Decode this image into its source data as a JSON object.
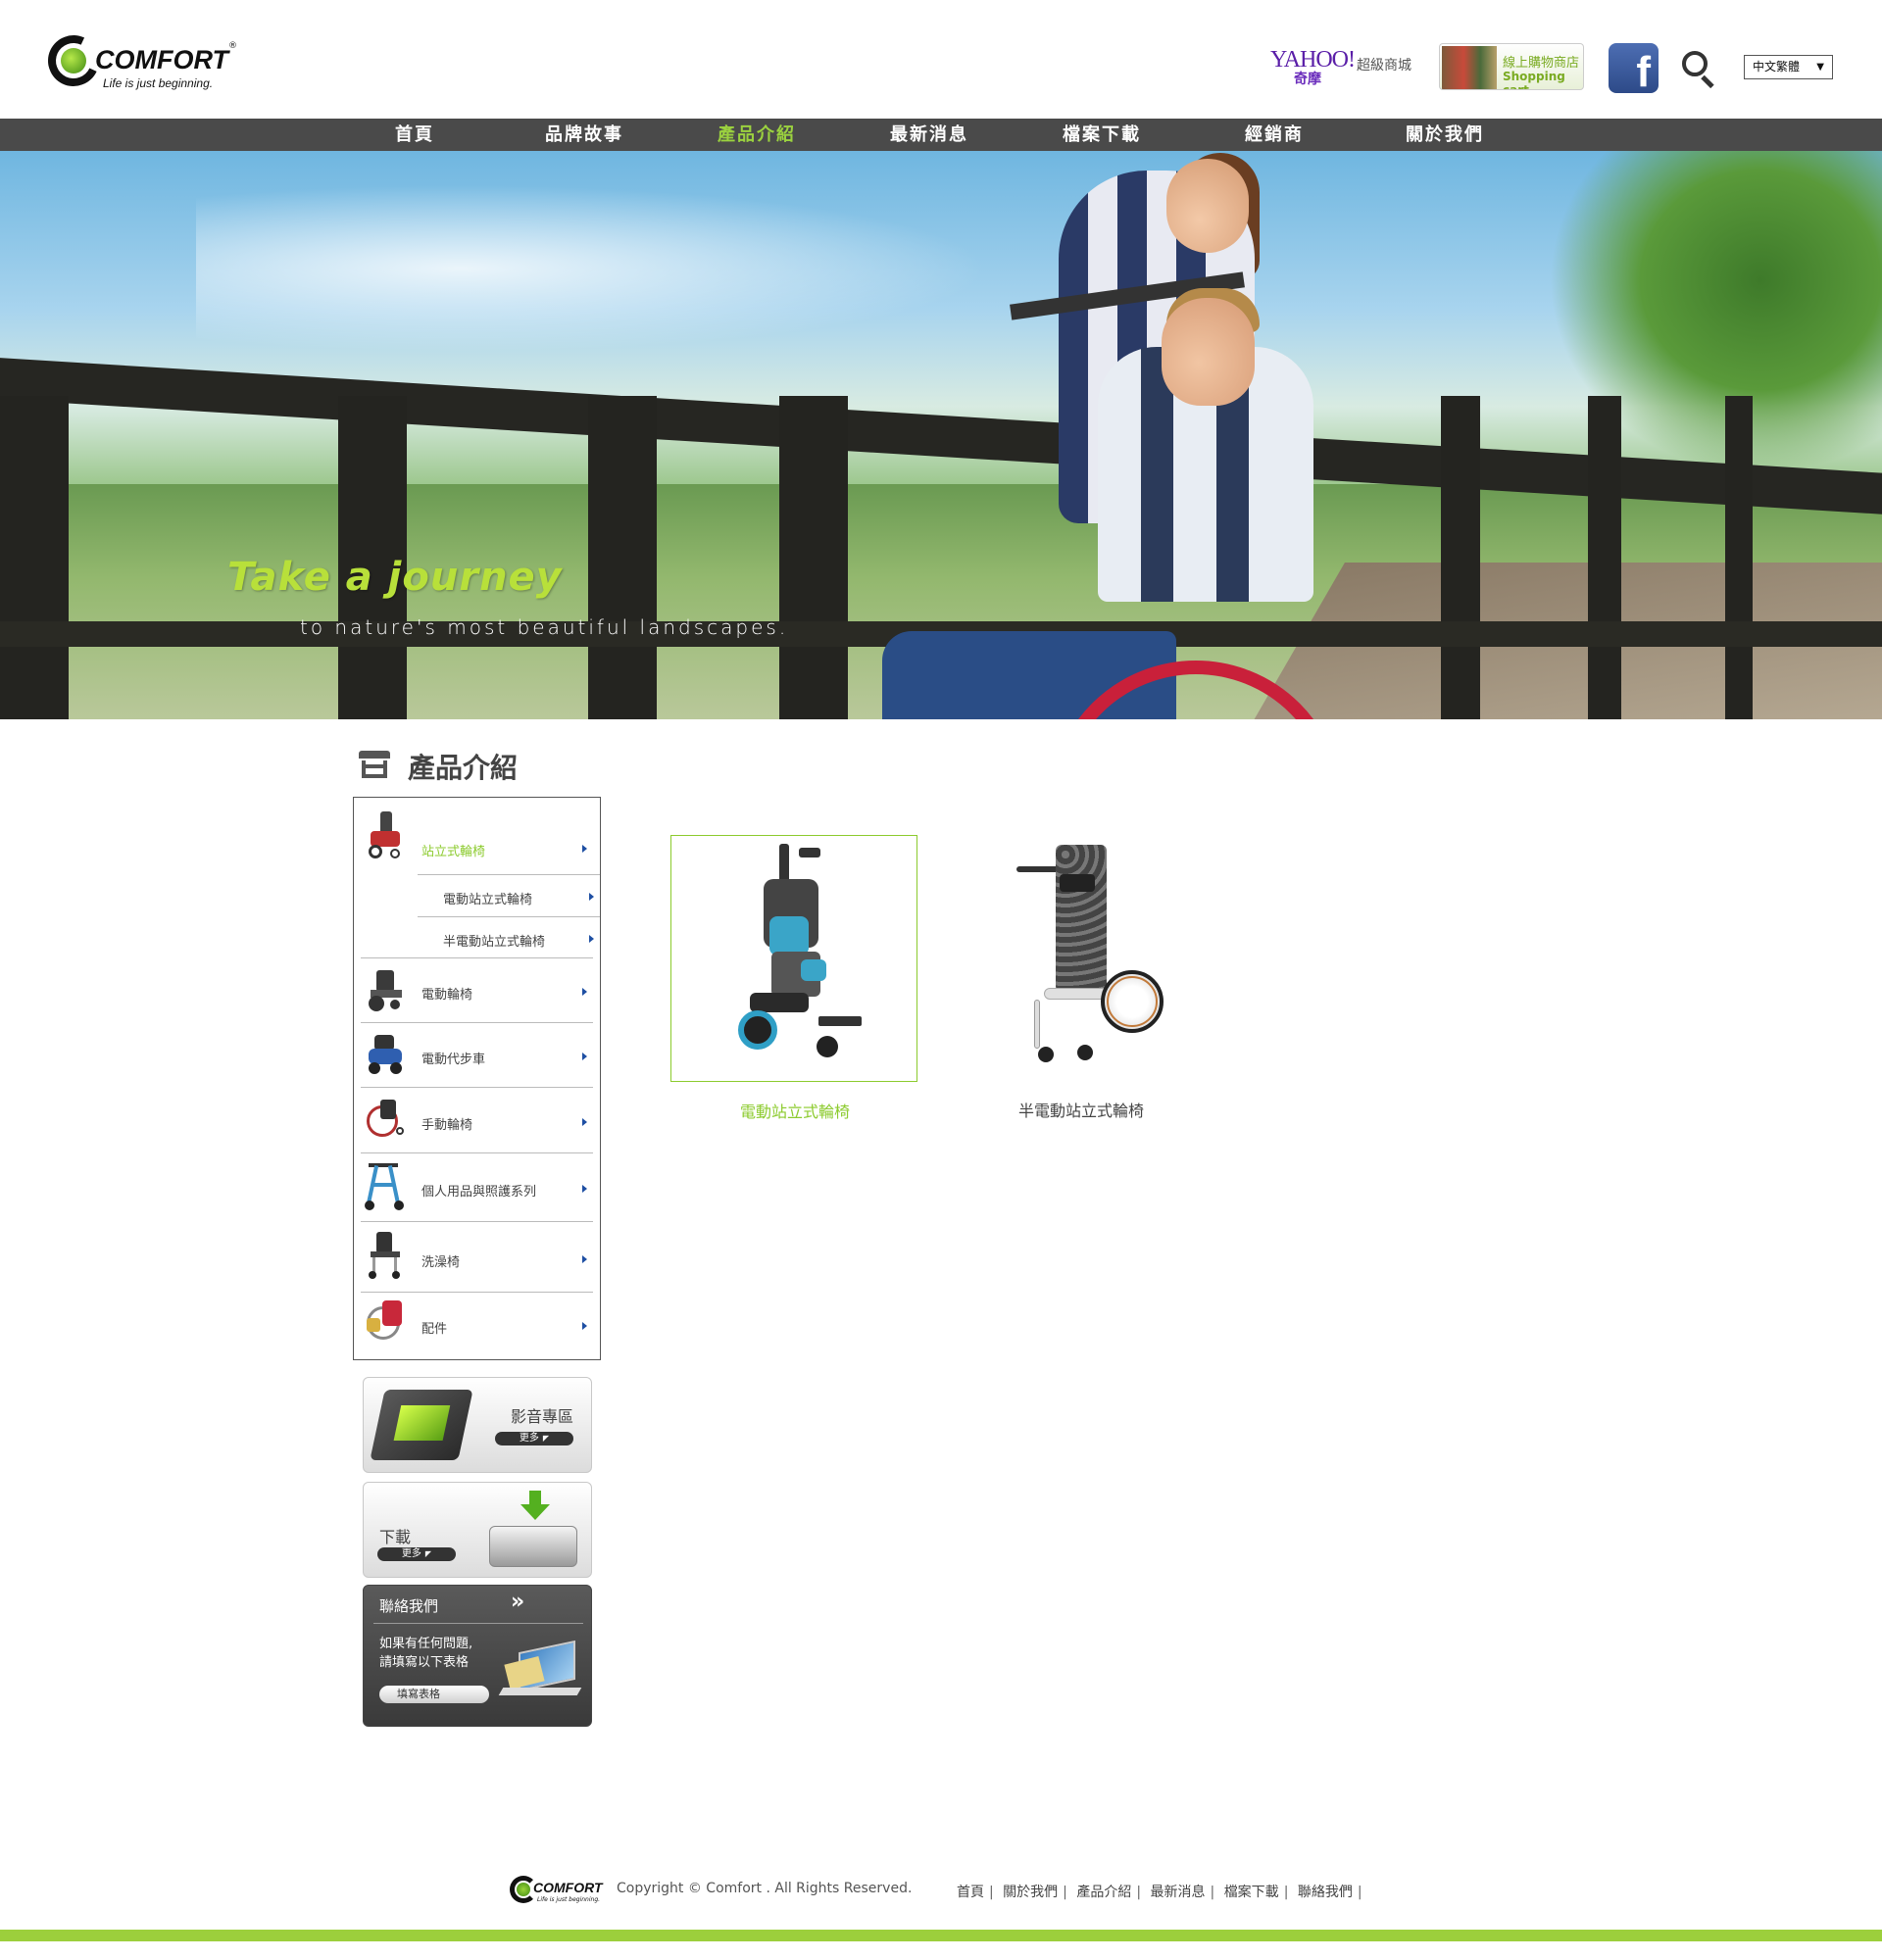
{
  "header": {
    "logo": {
      "word": "COMFORT",
      "reg": "®",
      "tagline": "Life is just beginning."
    },
    "yahoo": {
      "brand": "YAHOO!",
      "sub": "奇摩",
      "label": "超級商城"
    },
    "shop": {
      "line1": "線上購物商店",
      "line2": "Shopping cart"
    },
    "facebook": "f",
    "language": {
      "selected": "中文繁體",
      "arrow": "▼"
    }
  },
  "nav": {
    "items": [
      {
        "label": "首頁"
      },
      {
        "label": "品牌故事"
      },
      {
        "label": "產品介紹"
      },
      {
        "label": "最新消息"
      },
      {
        "label": "檔案下載"
      },
      {
        "label": "經銷商"
      },
      {
        "label": "關於我們"
      }
    ],
    "active_index": 2
  },
  "banner": {
    "headline": "Take a journey",
    "subline": "to nature's most beautiful landscapes."
  },
  "section": {
    "title": "產品介紹"
  },
  "categories": [
    {
      "label": "站立式輪椅",
      "active": true,
      "sub": [
        {
          "label": "電動站立式輪椅"
        },
        {
          "label": "半電動站立式輪椅"
        }
      ]
    },
    {
      "label": "電動輪椅"
    },
    {
      "label": "電動代步車"
    },
    {
      "label": "手動輪椅"
    },
    {
      "label": "個人用品與照護系列"
    },
    {
      "label": "洗澡椅"
    },
    {
      "label": "配件"
    }
  ],
  "promos": {
    "media": {
      "title": "影音專區",
      "more": "更多"
    },
    "download": {
      "title": "下載",
      "more": "更多"
    },
    "contact": {
      "title": "聯絡我們",
      "chevron": "»",
      "desc": "如果有任何問題,\n請填寫以下表格",
      "button": "填寫表格"
    }
  },
  "products": [
    {
      "label": "電動站立式輪椅",
      "selected": true
    },
    {
      "label": "半電動站立式輪椅",
      "selected": false
    }
  ],
  "footer": {
    "logo_word": "COMFORT",
    "logo_tag": "Life is just beginning.",
    "copyright": "Copyright © Comfort . All Rights Reserved.",
    "links": [
      "首頁",
      "關於我們",
      "產品介紹",
      "最新消息",
      "檔案下載",
      "聯絡我們"
    ],
    "separator": "|"
  },
  "colors": {
    "accent": "#8ccb2e",
    "nav_bg": "#4a4a4a",
    "footer_bar": "#9ccf3c"
  }
}
